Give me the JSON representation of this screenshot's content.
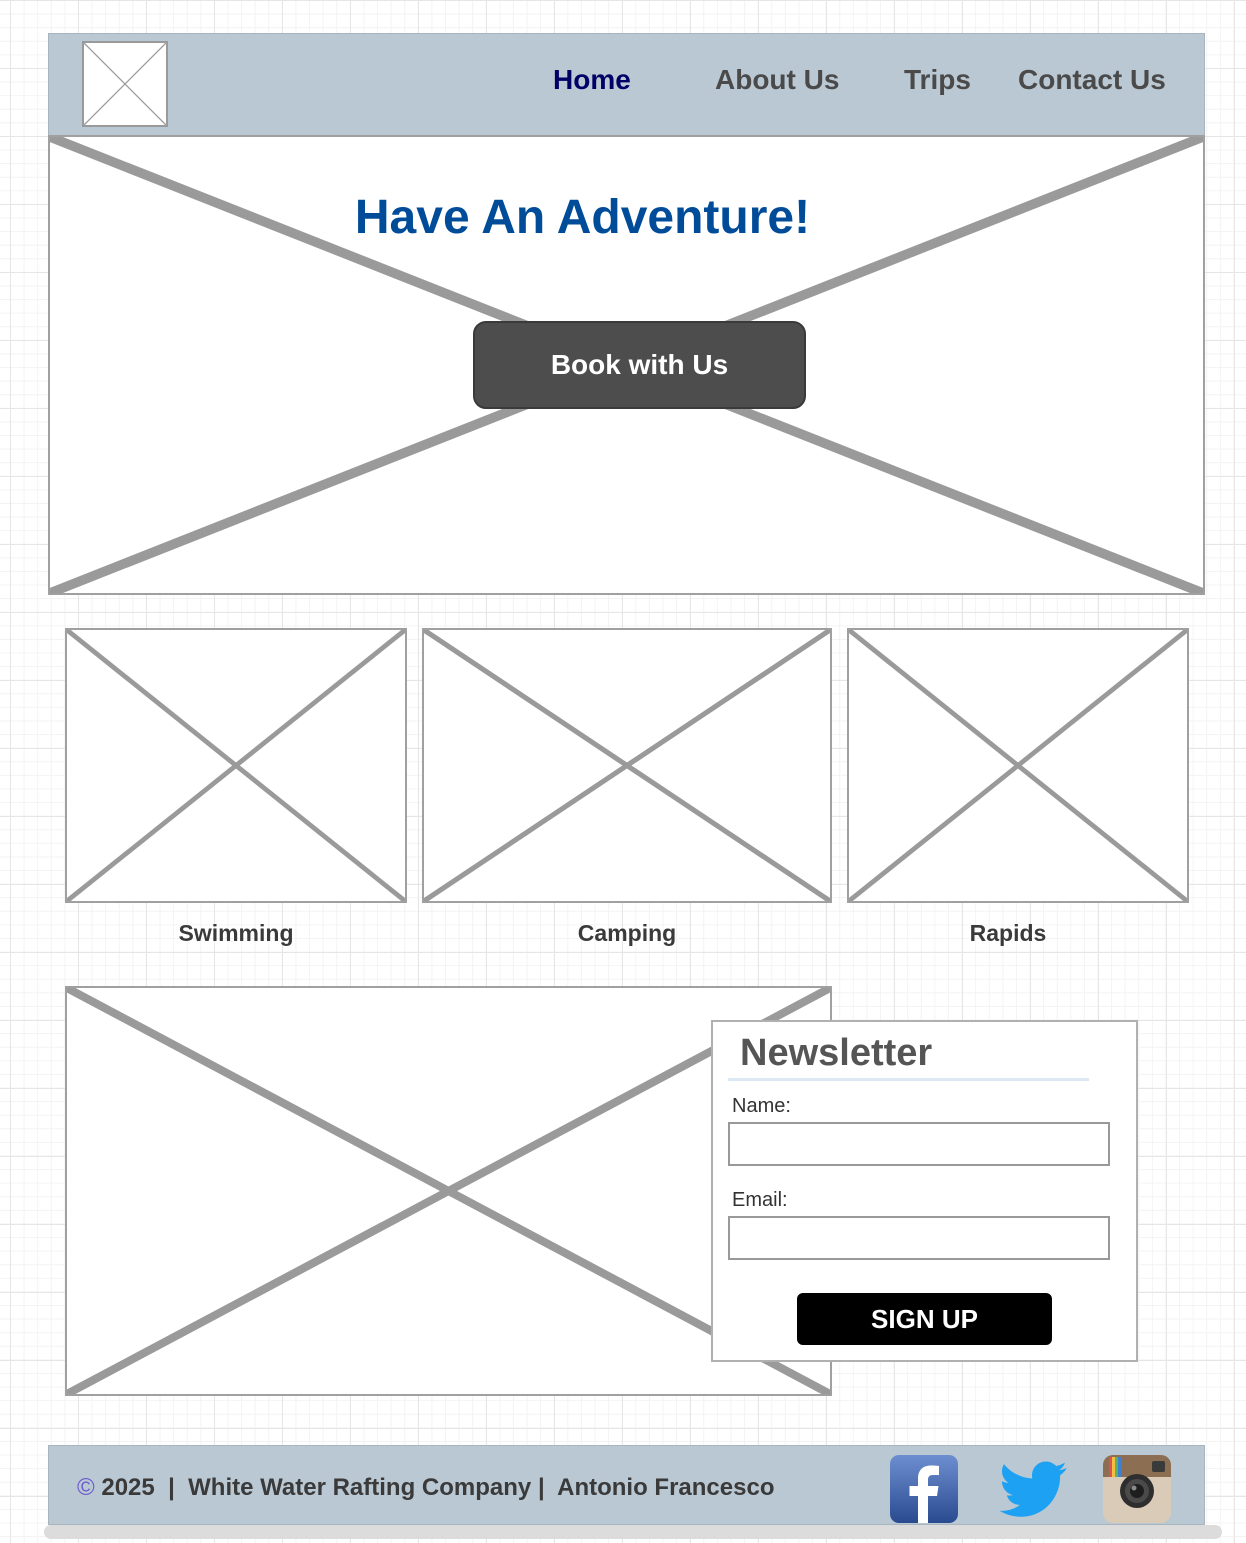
{
  "nav": {
    "items": [
      {
        "label": "Home",
        "active": true
      },
      {
        "label": "About Us"
      },
      {
        "label": "Trips"
      },
      {
        "label": "Contact Us"
      }
    ]
  },
  "hero": {
    "title": "Have An Adventure!",
    "button_label": "Book with Us"
  },
  "cards": [
    {
      "label": "Swimming"
    },
    {
      "label": "Camping"
    },
    {
      "label": "Rapids"
    }
  ],
  "newsletter": {
    "title": "Newsletter",
    "name_label": "Name:",
    "name_value": "",
    "email_label": "Email:",
    "email_value": "",
    "button_label": "SIGN UP"
  },
  "footer": {
    "copyright_symbol": "©",
    "year": "2025",
    "separator": "|",
    "company": "White Water Rafting Company",
    "author": "Antonio Francesco",
    "social": [
      "facebook-icon",
      "twitter-icon",
      "instagram-icon"
    ]
  },
  "colors": {
    "header_bg": "#bac8d3",
    "nav_active": "#000066",
    "nav_text": "#4a4a4a",
    "hero_title": "#004c99",
    "hero_button": "#4d4d4d",
    "signup_button": "#000000",
    "facebook": "#3b5998",
    "twitter": "#1da1f2"
  }
}
